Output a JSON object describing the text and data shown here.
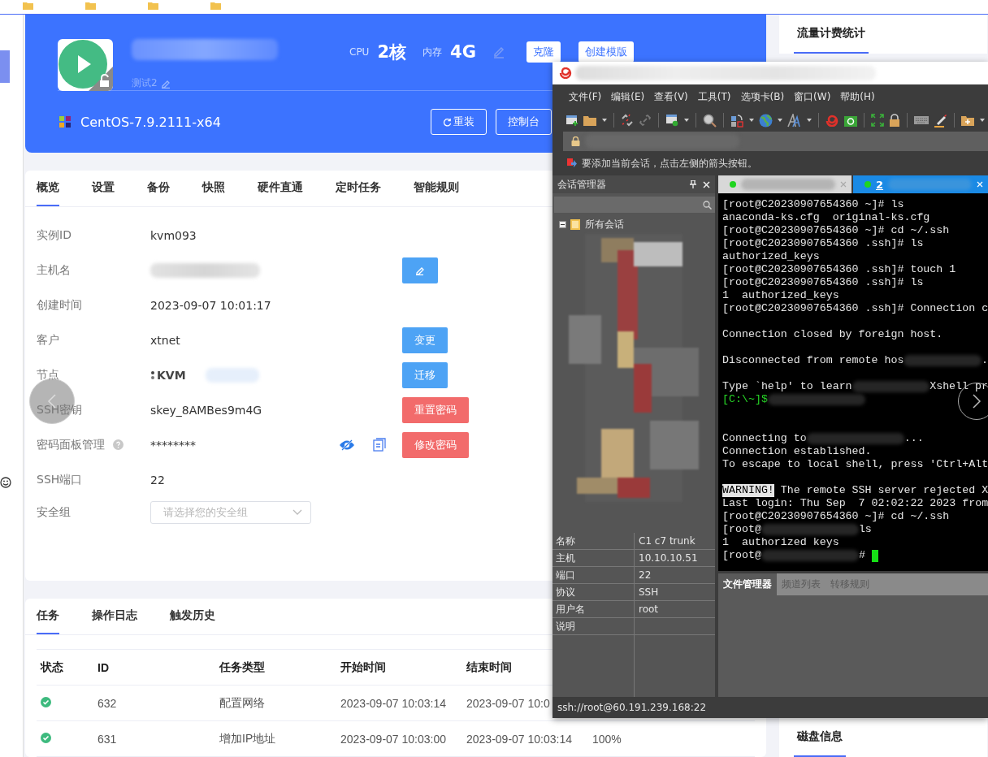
{
  "header": {
    "subtitle": "测试2",
    "cpu_label": "CPU",
    "cpu": "2核",
    "mem_label": "内存",
    "mem": "4G",
    "buttons": [
      "克隆",
      "创建模版"
    ],
    "os": "CentOS-7.9.2111-x64",
    "actions": [
      "重装",
      "控制台"
    ]
  },
  "detail_tabs": [
    {
      "label": "概览",
      "selected": true
    },
    {
      "label": "设置",
      "selected": false
    },
    {
      "label": "备份",
      "selected": false
    },
    {
      "label": "快照",
      "selected": false
    },
    {
      "label": "硬件直通",
      "selected": false
    },
    {
      "label": "定时任务",
      "selected": false
    },
    {
      "label": "智能规则",
      "selected": false
    }
  ],
  "details": [
    {
      "label": "实例ID",
      "kind": "text",
      "value": "kvm093"
    },
    {
      "label": "主机名",
      "kind": "redacted",
      "action": {
        "kind": "edit",
        "color": "#4da3f5"
      }
    },
    {
      "label": "创建时间",
      "kind": "text",
      "value": "2023-09-07 10:01:17"
    },
    {
      "label": "客户",
      "kind": "text",
      "value": "xtnet",
      "action": {
        "kind": "label",
        "label": "变更",
        "color": "#4da3f5"
      }
    },
    {
      "label": "节点",
      "kind": "node",
      "value": "KVM",
      "action": {
        "kind": "label",
        "label": "迁移",
        "color": "#4da3f5"
      }
    },
    {
      "label": "SSH密钥",
      "kind": "text",
      "value": "skey_8AMBes9m4G",
      "action": {
        "kind": "label",
        "label": "重置密码",
        "color": "#f26b6b"
      }
    },
    {
      "label": "密码面板管理",
      "kind": "password",
      "help": true,
      "value": "********",
      "action": {
        "kind": "label",
        "label": "修改密码",
        "color": "#f26b6b"
      }
    },
    {
      "label": "SSH端口",
      "kind": "text",
      "value": "22"
    },
    {
      "label": "安全组",
      "kind": "select",
      "placeholder": "请选择您的安全组"
    }
  ],
  "task_tabs": [
    {
      "label": "任务",
      "selected": true
    },
    {
      "label": "操作日志",
      "selected": false
    },
    {
      "label": "触发历史",
      "selected": false
    }
  ],
  "task_table": {
    "columns": [
      "状态",
      "ID",
      "任务类型",
      "开始时间",
      "结束时间"
    ],
    "rows": [
      {
        "success": true,
        "id": "632",
        "type": "配置网络",
        "start": "2023-09-07 10:03:14",
        "end": "2023-09-07 10:0"
      },
      {
        "success": true,
        "id": "631",
        "type": "增加IP地址",
        "start": "2023-09-07 10:03:00",
        "end": "2023-09-07 10:03:14",
        "progress": "100%"
      }
    ]
  },
  "right_cards": [
    "流量计费统计",
    "磁盘信息"
  ],
  "xshell": {
    "menu": [
      "文件(F)",
      "编辑(E)",
      "查看(V)",
      "工具(T)",
      "选项卡(B)",
      "窗口(W)",
      "帮助(H)"
    ],
    "hint": "要添加当前会话，点击左侧的箭头按钮。",
    "session_manager": {
      "title": "会话管理器",
      "root": "所有会话",
      "properties": [
        {
          "name": "名称",
          "value": "C1 c7 trunk"
        },
        {
          "name": "主机",
          "value": "10.10.10.51"
        },
        {
          "name": "端口",
          "value": "22"
        },
        {
          "name": "协议",
          "value": "SSH"
        },
        {
          "name": "用户名",
          "value": "root"
        },
        {
          "name": "说明"
        }
      ]
    },
    "tabs": [
      {
        "selected": false
      },
      {
        "label": "2",
        "selected": true
      }
    ],
    "terminal": [
      {
        "kind": "text",
        "parts": [
          "[root@C20230907654360 ~]# ls"
        ]
      },
      {
        "kind": "text",
        "parts": [
          "anaconda-ks.cfg  original-ks.cfg"
        ]
      },
      {
        "kind": "text",
        "parts": [
          "[root@C20230907654360 ~]# cd ~/.ssh"
        ]
      },
      {
        "kind": "text",
        "parts": [
          "[root@C20230907654360 .ssh]# ls"
        ]
      },
      {
        "kind": "text",
        "parts": [
          "authorized_keys"
        ]
      },
      {
        "kind": "text",
        "parts": [
          "[root@C20230907654360 .ssh]# touch 1"
        ]
      },
      {
        "kind": "text",
        "parts": [
          "[root@C20230907654360 .ssh]# ls"
        ]
      },
      {
        "kind": "text",
        "parts": [
          "1  authorized_keys"
        ]
      },
      {
        "kind": "text",
        "parts": [
          "[root@C20230907654360 .ssh]# Connection c"
        ]
      },
      {
        "kind": "blank"
      },
      {
        "kind": "text",
        "parts": [
          "Connection closed by foreign host."
        ]
      },
      {
        "kind": "blank"
      },
      {
        "kind": "text",
        "parts": [
          "Disconnected from remote hos",
          "."
        ]
      },
      {
        "kind": "blank"
      },
      {
        "kind": "text",
        "parts": [
          "Type `help' to learn",
          "Xshell pr"
        ]
      },
      {
        "kind": "prompt",
        "parts": [
          "[C:\\~]$"
        ],
        "blur_after": true
      },
      {
        "kind": "blank"
      },
      {
        "kind": "blank"
      },
      {
        "kind": "text",
        "parts": [
          "Connecting to",
          "..."
        ]
      },
      {
        "kind": "text",
        "parts": [
          "Connection established."
        ]
      },
      {
        "kind": "text",
        "parts": [
          "To escape to local shell, press 'Ctrl+Alt"
        ]
      },
      {
        "kind": "blank"
      },
      {
        "kind": "warning",
        "badge": "WARNING!",
        "parts": [
          " The remote SSH server rejected X"
        ]
      },
      {
        "kind": "text",
        "parts": [
          "Last login: Thu Sep  7 02:02:22 2023 from"
        ]
      },
      {
        "kind": "text",
        "parts": [
          "[root@C20230907654360 ~]# cd ~/.ssh"
        ]
      },
      {
        "kind": "text",
        "parts": [
          "[root@",
          "ls"
        ]
      },
      {
        "kind": "text",
        "parts": [
          "1  authorized keys"
        ]
      },
      {
        "kind": "text",
        "parts": [
          "[root@",
          "# "
        ],
        "cursor": true
      }
    ],
    "bottom_tabs": [
      {
        "label": "文件管理器",
        "selected": true
      },
      {
        "label": "频道列表",
        "selected": false
      },
      {
        "label": "转移规则",
        "selected": false
      }
    ],
    "status": "ssh://root@60.191.239.168:22"
  }
}
